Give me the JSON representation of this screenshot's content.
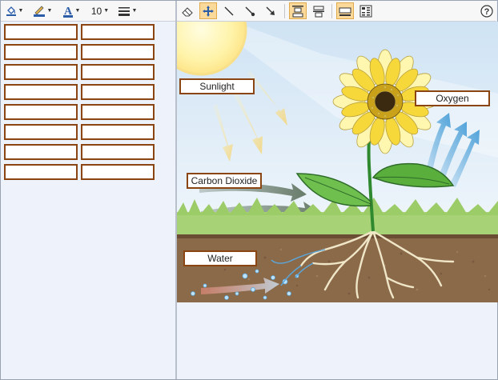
{
  "toolbar": {
    "fill_tool": "paint-bucket-icon",
    "line_color_tool": "pen-color-icon",
    "text_color_tool": "text-color-icon",
    "text_color_glyph": "A",
    "font_size": "10",
    "line_width_tool": "line-width-icon",
    "eraser_tool": "eraser-icon",
    "move_tool": "move-icon",
    "line_tool": "line-icon",
    "line_dot_tool": "line-end-dot-icon",
    "arrow_tool": "arrow-icon",
    "help": "?",
    "accent_active": "#fbd99a"
  },
  "labels": {
    "sunlight": "Sunlight",
    "carbon_dioxide": "Carbon Dioxide",
    "oxygen": "Oxygen",
    "water": "Water"
  },
  "label_bank": {
    "rows": 8,
    "columns": 2,
    "border_color": "#8b4513"
  },
  "diagram": {
    "sky_color": "#dbeaf6",
    "soil_color": "#8b6a4a",
    "grass_color": "#9ccc68"
  }
}
